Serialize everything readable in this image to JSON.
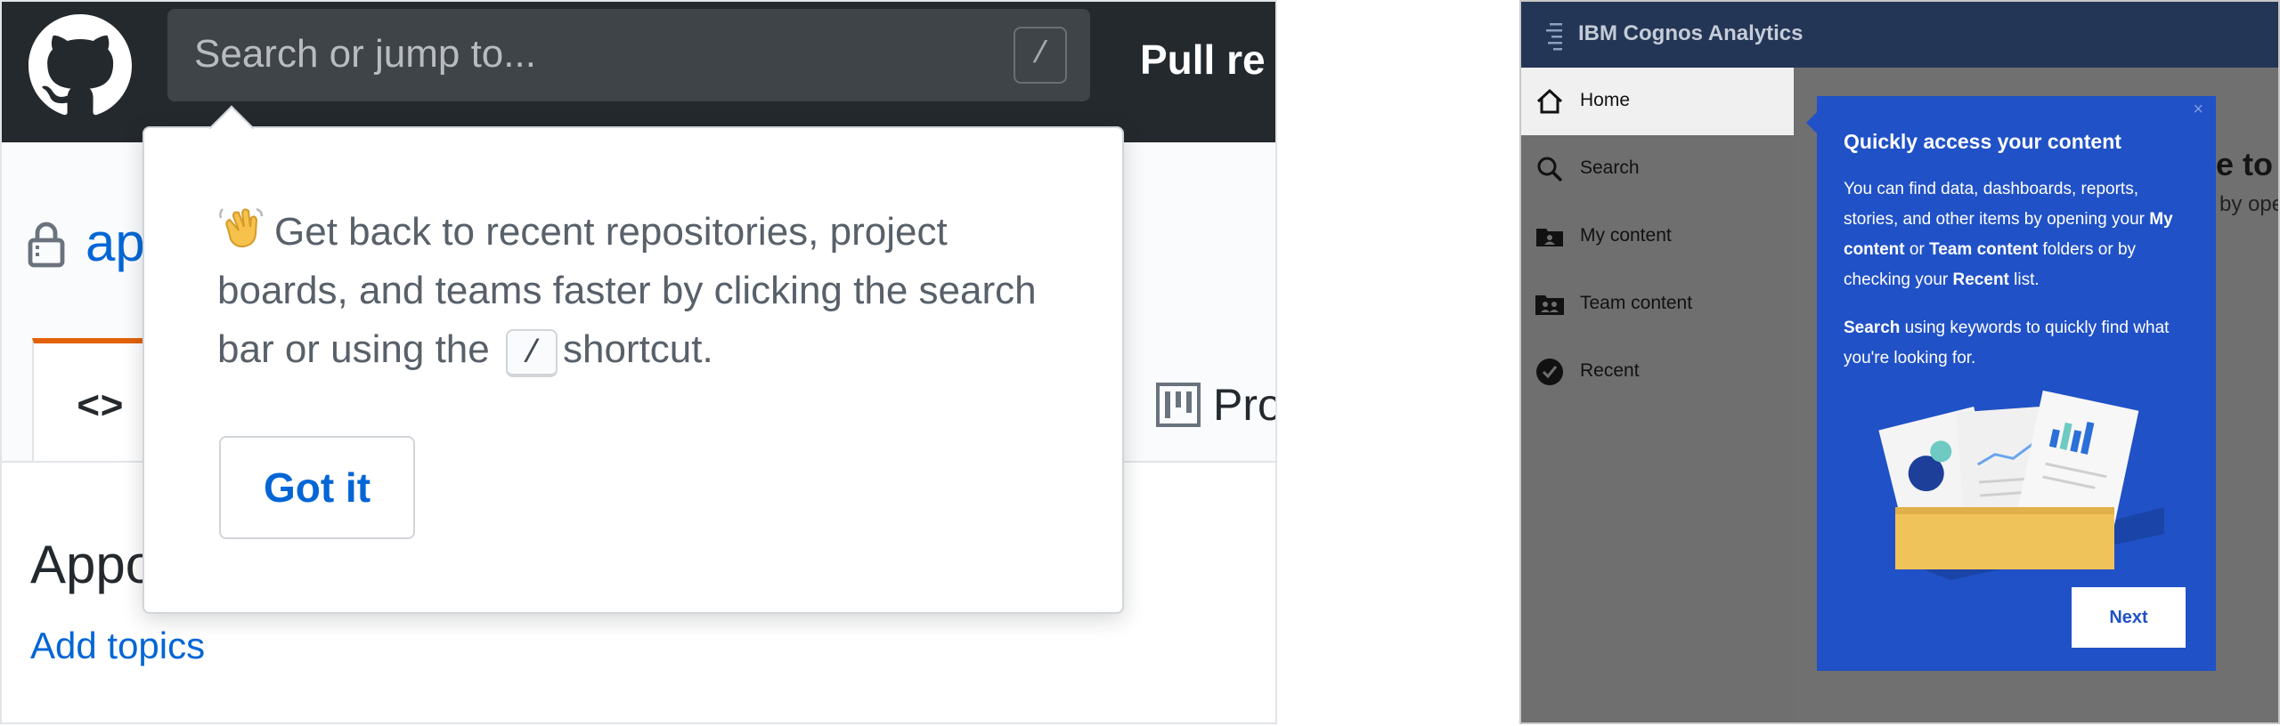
{
  "github": {
    "search": {
      "placeholder": "Search or jump to...",
      "shortcut_key": "/"
    },
    "nav_partial": "Pull re",
    "repo_partial": "ap",
    "tabs": {
      "code_partial": "<> C",
      "projects_partial": "Pro"
    },
    "about_partial": "Appo",
    "add_topics": "Add topics",
    "popover": {
      "text_before": "Get back to recent repositories, project boards, and teams faster by clicking the search bar or using the",
      "shortcut": "/",
      "text_after": "shortcut.",
      "button": "Got it"
    },
    "colors": {
      "header": "#24292e",
      "link": "#0366d6",
      "tab_accent": "#e36209"
    }
  },
  "ibm": {
    "app_title": "IBM Cognos Analytics",
    "nav": [
      {
        "label": "Home",
        "icon": "home-icon"
      },
      {
        "label": "Search",
        "icon": "search-icon"
      },
      {
        "label": "My content",
        "icon": "my-content-icon"
      },
      {
        "label": "Team content",
        "icon": "team-content-icon"
      },
      {
        "label": "Recent",
        "icon": "recent-icon"
      }
    ],
    "main_partial_1": "ne to",
    "main_partial_2": "by ope",
    "popover": {
      "close": "×",
      "title": "Quickly access your content",
      "body1_a": "You can find data, dashboards, reports, stories, and other items by opening your",
      "body1_my": "My content",
      "body1_or": "or",
      "body1_team": "Team content",
      "body1_b": "folders or by checking your",
      "body1_recent": "Recent",
      "body1_c": "list.",
      "body2_search": "Search",
      "body2_rest": "using keywords to quickly find what you're looking for.",
      "button": "Next"
    },
    "colors": {
      "header": "#243655",
      "popover": "#2051c6",
      "box": "#f0c35a"
    }
  }
}
